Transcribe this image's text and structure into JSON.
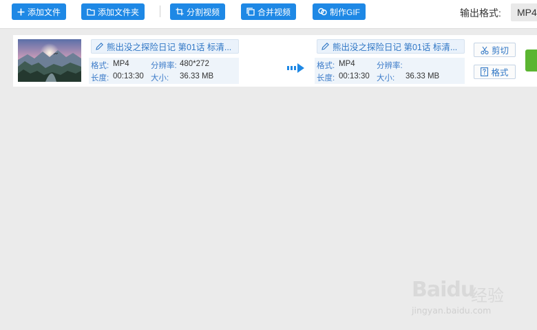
{
  "toolbar": {
    "add_file": "添加文件",
    "add_folder": "添加文件夹",
    "split_video": "分割视频",
    "merge_video": "合并视频",
    "make_gif": "制作GIF",
    "output_format_label": "输出格式:",
    "output_format_value": "MP4",
    "accent_color": "#1e88e5"
  },
  "file_row": {
    "source": {
      "name": "熊出没之探险日记 第01话 标清...",
      "format_label": "格式:",
      "format_value": "MP4",
      "resolution_label": "分辨率:",
      "resolution_value": "480*272",
      "duration_label": "长度:",
      "duration_value": "00:13:30",
      "size_label": "大小:",
      "size_value": "36.33 MB"
    },
    "target": {
      "name": "熊出没之探险日记 第01话 标清...",
      "format_label": "格式:",
      "format_value": "MP4",
      "resolution_label": "分辨率:",
      "resolution_value": "",
      "duration_label": "长度:",
      "duration_value": "00:13:30",
      "size_label": "大小:",
      "size_value": "36.33 MB"
    },
    "cut_button": "剪切",
    "format_button": "格式",
    "convert_color": "#5bb531"
  },
  "watermark": {
    "brand": "Baidu",
    "suffix": "经验",
    "url": "jingyan.baidu.com"
  }
}
